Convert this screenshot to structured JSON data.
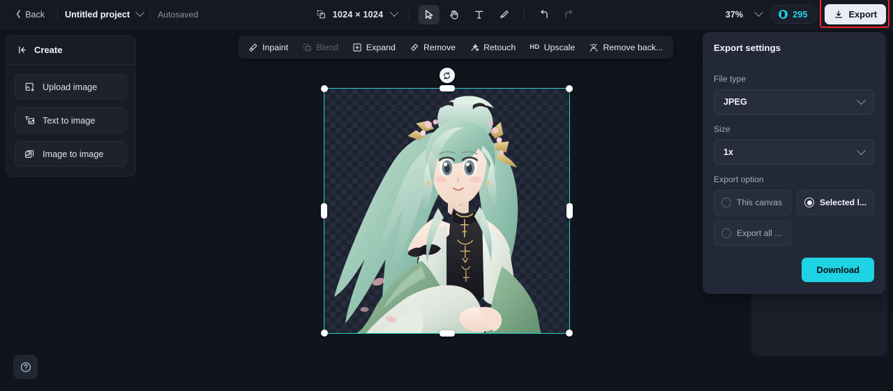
{
  "topbar": {
    "back_label": "Back",
    "project_name": "Untitled project",
    "autosave_status": "Autosaved",
    "canvas_size": "1024 × 1024",
    "zoom_level": "37%",
    "credits": "295",
    "export_label": "Export",
    "tools": [
      {
        "name": "select-tool",
        "icon": "cursor-icon",
        "active": true
      },
      {
        "name": "hand-tool",
        "icon": "hand-icon",
        "active": false
      },
      {
        "name": "text-tool",
        "icon": "text-icon",
        "active": false
      },
      {
        "name": "brush-tool",
        "icon": "brush-icon",
        "active": false
      },
      {
        "name": "undo",
        "icon": "undo-icon",
        "active": false
      },
      {
        "name": "redo",
        "icon": "redo-icon",
        "active": false
      }
    ]
  },
  "sidebar": {
    "title": "Create",
    "collapse_icon": "collapse-left-icon",
    "items": [
      {
        "label": "Upload image",
        "icon": "upload-image-icon"
      },
      {
        "label": "Text to image",
        "icon": "text-to-image-icon"
      },
      {
        "label": "Image to image",
        "icon": "image-to-image-icon"
      }
    ],
    "help_icon": "help-circle-icon"
  },
  "canvas_toolbar": {
    "items": [
      {
        "label": "Inpaint",
        "icon": "inpaint-icon",
        "disabled": false
      },
      {
        "label": "Blend",
        "icon": "blend-icon",
        "disabled": true
      },
      {
        "label": "Expand",
        "icon": "expand-icon",
        "disabled": false
      },
      {
        "label": "Remove",
        "icon": "remove-icon",
        "disabled": false
      },
      {
        "label": "Retouch",
        "icon": "retouch-icon",
        "disabled": false
      },
      {
        "label": "Upscale",
        "icon": "hd-upscale-icon",
        "disabled": false,
        "badge": "HD"
      },
      {
        "label": "Remove back...",
        "icon": "remove-background-icon",
        "disabled": false
      }
    ]
  },
  "canvas": {
    "selection_color": "#23d3c8",
    "rotate_icon": "rotate-icon",
    "artwork_alt": "anime character with mint green hair and gold hair ornaments"
  },
  "export_panel": {
    "title": "Export settings",
    "file_type_label": "File type",
    "file_type_value": "JPEG",
    "size_label": "Size",
    "size_value": "1x",
    "export_option_label": "Export option",
    "options": [
      {
        "label": "This canvas",
        "selected": false
      },
      {
        "label": "Selected l...",
        "selected": true
      },
      {
        "label": "Export all ...",
        "selected": false
      }
    ],
    "download_label": "Download",
    "download_color": "#1ed3e3"
  }
}
